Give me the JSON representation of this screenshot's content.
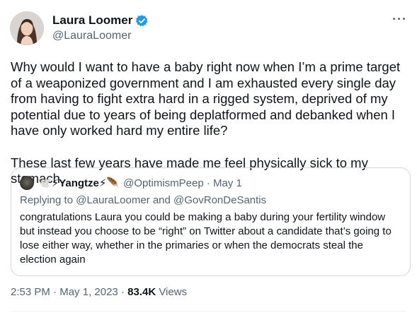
{
  "author": {
    "display_name": "Laura Loomer",
    "handle": "@LauraLoomer",
    "verified": true
  },
  "tweet": {
    "text": "Why would I want to have a baby right now when I’m a prime target of a weaponized government and I am exhausted every single day from having to fight extra hard in a rigged system, deprived of my potential due to years of being deplatformed and debanked when I have only worked hard my entire life?\n\nThese last few years have made me feel physically sick to my stomach.",
    "time": "2:53 PM",
    "date": "May 1, 2023",
    "views_count": "83.4K",
    "views_label": "Views"
  },
  "more_menu": {
    "label": "···"
  },
  "quote": {
    "display_name": "🕊️⚡Yangtze⚡🪶",
    "handle_and_date": "@OptimismPeep · May 1",
    "replying_to": "Replying to @LauraLoomer and @GovRonDeSantis",
    "text": "congratulations Laura you could be making a baby during your fertility window but instead you choose to be “right” on Twitter about a candidate that’s going to lose either way, whether in the primaries or when the democrats steal the election again"
  },
  "colors": {
    "text_primary": "#0f1419",
    "text_secondary": "#536471",
    "verified_blue": "#1d9bf0",
    "border": "#cfd9de"
  }
}
